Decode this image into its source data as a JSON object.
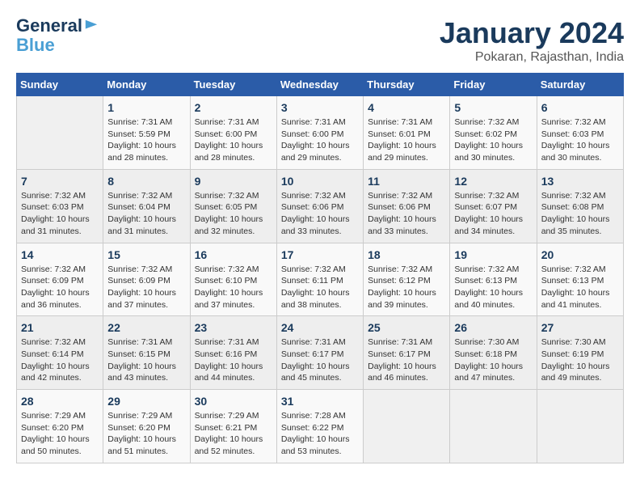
{
  "header": {
    "logo_line1": "General",
    "logo_line2": "Blue",
    "month_year": "January 2024",
    "location": "Pokaran, Rajasthan, India"
  },
  "weekdays": [
    "Sunday",
    "Monday",
    "Tuesday",
    "Wednesday",
    "Thursday",
    "Friday",
    "Saturday"
  ],
  "weeks": [
    [
      {
        "day": "",
        "sunrise": "",
        "sunset": "",
        "daylight": ""
      },
      {
        "day": "1",
        "sunrise": "Sunrise: 7:31 AM",
        "sunset": "Sunset: 5:59 PM",
        "daylight": "Daylight: 10 hours and 28 minutes."
      },
      {
        "day": "2",
        "sunrise": "Sunrise: 7:31 AM",
        "sunset": "Sunset: 6:00 PM",
        "daylight": "Daylight: 10 hours and 28 minutes."
      },
      {
        "day": "3",
        "sunrise": "Sunrise: 7:31 AM",
        "sunset": "Sunset: 6:00 PM",
        "daylight": "Daylight: 10 hours and 29 minutes."
      },
      {
        "day": "4",
        "sunrise": "Sunrise: 7:31 AM",
        "sunset": "Sunset: 6:01 PM",
        "daylight": "Daylight: 10 hours and 29 minutes."
      },
      {
        "day": "5",
        "sunrise": "Sunrise: 7:32 AM",
        "sunset": "Sunset: 6:02 PM",
        "daylight": "Daylight: 10 hours and 30 minutes."
      },
      {
        "day": "6",
        "sunrise": "Sunrise: 7:32 AM",
        "sunset": "Sunset: 6:03 PM",
        "daylight": "Daylight: 10 hours and 30 minutes."
      }
    ],
    [
      {
        "day": "7",
        "sunrise": "Sunrise: 7:32 AM",
        "sunset": "Sunset: 6:03 PM",
        "daylight": "Daylight: 10 hours and 31 minutes."
      },
      {
        "day": "8",
        "sunrise": "Sunrise: 7:32 AM",
        "sunset": "Sunset: 6:04 PM",
        "daylight": "Daylight: 10 hours and 31 minutes."
      },
      {
        "day": "9",
        "sunrise": "Sunrise: 7:32 AM",
        "sunset": "Sunset: 6:05 PM",
        "daylight": "Daylight: 10 hours and 32 minutes."
      },
      {
        "day": "10",
        "sunrise": "Sunrise: 7:32 AM",
        "sunset": "Sunset: 6:06 PM",
        "daylight": "Daylight: 10 hours and 33 minutes."
      },
      {
        "day": "11",
        "sunrise": "Sunrise: 7:32 AM",
        "sunset": "Sunset: 6:06 PM",
        "daylight": "Daylight: 10 hours and 33 minutes."
      },
      {
        "day": "12",
        "sunrise": "Sunrise: 7:32 AM",
        "sunset": "Sunset: 6:07 PM",
        "daylight": "Daylight: 10 hours and 34 minutes."
      },
      {
        "day": "13",
        "sunrise": "Sunrise: 7:32 AM",
        "sunset": "Sunset: 6:08 PM",
        "daylight": "Daylight: 10 hours and 35 minutes."
      }
    ],
    [
      {
        "day": "14",
        "sunrise": "Sunrise: 7:32 AM",
        "sunset": "Sunset: 6:09 PM",
        "daylight": "Daylight: 10 hours and 36 minutes."
      },
      {
        "day": "15",
        "sunrise": "Sunrise: 7:32 AM",
        "sunset": "Sunset: 6:09 PM",
        "daylight": "Daylight: 10 hours and 37 minutes."
      },
      {
        "day": "16",
        "sunrise": "Sunrise: 7:32 AM",
        "sunset": "Sunset: 6:10 PM",
        "daylight": "Daylight: 10 hours and 37 minutes."
      },
      {
        "day": "17",
        "sunrise": "Sunrise: 7:32 AM",
        "sunset": "Sunset: 6:11 PM",
        "daylight": "Daylight: 10 hours and 38 minutes."
      },
      {
        "day": "18",
        "sunrise": "Sunrise: 7:32 AM",
        "sunset": "Sunset: 6:12 PM",
        "daylight": "Daylight: 10 hours and 39 minutes."
      },
      {
        "day": "19",
        "sunrise": "Sunrise: 7:32 AM",
        "sunset": "Sunset: 6:13 PM",
        "daylight": "Daylight: 10 hours and 40 minutes."
      },
      {
        "day": "20",
        "sunrise": "Sunrise: 7:32 AM",
        "sunset": "Sunset: 6:13 PM",
        "daylight": "Daylight: 10 hours and 41 minutes."
      }
    ],
    [
      {
        "day": "21",
        "sunrise": "Sunrise: 7:32 AM",
        "sunset": "Sunset: 6:14 PM",
        "daylight": "Daylight: 10 hours and 42 minutes."
      },
      {
        "day": "22",
        "sunrise": "Sunrise: 7:31 AM",
        "sunset": "Sunset: 6:15 PM",
        "daylight": "Daylight: 10 hours and 43 minutes."
      },
      {
        "day": "23",
        "sunrise": "Sunrise: 7:31 AM",
        "sunset": "Sunset: 6:16 PM",
        "daylight": "Daylight: 10 hours and 44 minutes."
      },
      {
        "day": "24",
        "sunrise": "Sunrise: 7:31 AM",
        "sunset": "Sunset: 6:17 PM",
        "daylight": "Daylight: 10 hours and 45 minutes."
      },
      {
        "day": "25",
        "sunrise": "Sunrise: 7:31 AM",
        "sunset": "Sunset: 6:17 PM",
        "daylight": "Daylight: 10 hours and 46 minutes."
      },
      {
        "day": "26",
        "sunrise": "Sunrise: 7:30 AM",
        "sunset": "Sunset: 6:18 PM",
        "daylight": "Daylight: 10 hours and 47 minutes."
      },
      {
        "day": "27",
        "sunrise": "Sunrise: 7:30 AM",
        "sunset": "Sunset: 6:19 PM",
        "daylight": "Daylight: 10 hours and 49 minutes."
      }
    ],
    [
      {
        "day": "28",
        "sunrise": "Sunrise: 7:29 AM",
        "sunset": "Sunset: 6:20 PM",
        "daylight": "Daylight: 10 hours and 50 minutes."
      },
      {
        "day": "29",
        "sunrise": "Sunrise: 7:29 AM",
        "sunset": "Sunset: 6:20 PM",
        "daylight": "Daylight: 10 hours and 51 minutes."
      },
      {
        "day": "30",
        "sunrise": "Sunrise: 7:29 AM",
        "sunset": "Sunset: 6:21 PM",
        "daylight": "Daylight: 10 hours and 52 minutes."
      },
      {
        "day": "31",
        "sunrise": "Sunrise: 7:28 AM",
        "sunset": "Sunset: 6:22 PM",
        "daylight": "Daylight: 10 hours and 53 minutes."
      },
      {
        "day": "",
        "sunrise": "",
        "sunset": "",
        "daylight": ""
      },
      {
        "day": "",
        "sunrise": "",
        "sunset": "",
        "daylight": ""
      },
      {
        "day": "",
        "sunrise": "",
        "sunset": "",
        "daylight": ""
      }
    ]
  ]
}
